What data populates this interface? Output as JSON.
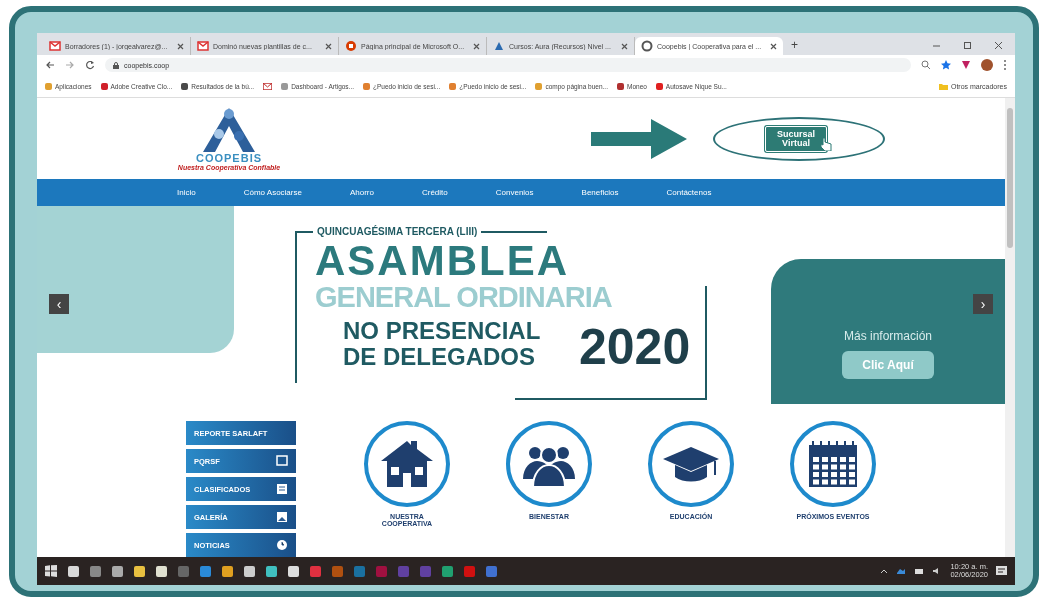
{
  "browser": {
    "tabs": [
      {
        "label": "Borradores (1) - jorgealvarez@...",
        "selected": false
      },
      {
        "label": "Dominó nuevas plantillas de c...",
        "selected": false
      },
      {
        "label": "Página principal de Microsoft O...",
        "selected": false
      },
      {
        "label": "Cursos: Aura (Recursos) Nivel ...",
        "selected": false
      },
      {
        "label": "Coopebis | Cooperativa para el ...",
        "selected": true
      }
    ],
    "new_tab": "+",
    "url": "coopebis.coop",
    "bookmarks": [
      {
        "label": "Aplicaciones",
        "color": "#e0a030"
      },
      {
        "label": "Adobe Creative Clo...",
        "color": "#d0202a"
      },
      {
        "label": "Resultados de la bú...",
        "color": "#4a4a4a"
      },
      {
        "label": "Dashboard - Artigos...",
        "color": "#999999"
      },
      {
        "label": "¿Puedo inicio de sesi...",
        "color": "#e08030"
      },
      {
        "label": "¿Puedo inicio de sesi...",
        "color": "#e08030"
      },
      {
        "label": "compo página buen...",
        "color": "#e0a030"
      },
      {
        "label": "Moneo",
        "color": "#b03030"
      },
      {
        "label": "Autosave Nique Su...",
        "color": "#e02020"
      }
    ],
    "other_bookmarks": "Otros marcadores"
  },
  "site": {
    "logo_name": "COOPEBIS",
    "logo_tagline": "Nuestra Cooperativa Confiable",
    "virtual_button": "Sucursal Virtual",
    "nav": [
      "Inicio",
      "Cómo Asociarse",
      "Ahorro",
      "Crédito",
      "Convenios",
      "Beneficios",
      "Contáctenos"
    ],
    "banner": {
      "line_1": "QUINCUAGÉSIMA TERCERA (LIII)",
      "line_2": "ASAMBLEA",
      "line_3": "GENERAL ORDINARIA",
      "line_4": "NO PRESENCIAL",
      "line_5": "DE DELEGADOS",
      "year": "2020",
      "info": "Más información",
      "cta": "Clic Aquí",
      "prev": "‹",
      "next": "›"
    },
    "side_links": [
      "REPORTE SARLAFT",
      "PQRSF",
      "CLASIFICADOS",
      "GALERÍA",
      "NOTICIAS"
    ],
    "features": [
      {
        "label": "NUESTRA COOPERATIVA",
        "kind": "house"
      },
      {
        "label": "BIENESTAR",
        "kind": "people"
      },
      {
        "label": "EDUCACIÓN",
        "kind": "cap"
      },
      {
        "label": "PRÓXIMOS EVENTOS",
        "kind": "calendar"
      }
    ]
  },
  "taskbar": {
    "time": "10:20 a. m.",
    "date": "02/06/2020"
  }
}
